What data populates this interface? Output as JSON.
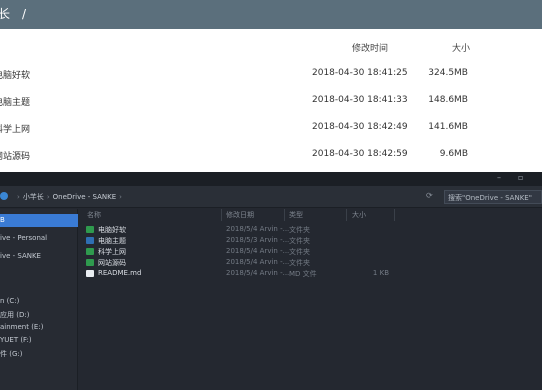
{
  "web": {
    "breadcrumb": {
      "current": "长",
      "separator": "/"
    },
    "columns": {
      "date": "修改时间",
      "size": "大小"
    },
    "rows": [
      {
        "name": "电脑好软",
        "date": "2018-04-30 18:41:25",
        "size": "324.5MB"
      },
      {
        "name": "电脑主题",
        "date": "2018-04-30 18:41:33",
        "size": "148.6MB"
      },
      {
        "name": "科学上网",
        "date": "2018-04-30 18:42:49",
        "size": "141.6MB"
      },
      {
        "name": "网站源码",
        "date": "2018-04-30 18:42:59",
        "size": "9.6MB"
      }
    ]
  },
  "explorer": {
    "titlebar": {
      "minimize": "–",
      "maximize": "▫"
    },
    "address": {
      "segments": [
        "小芊长",
        "OneDrive - SANKE"
      ],
      "search_placeholder": "搜索\"OneDrive - SANKE\""
    },
    "sidebar": [
      {
        "label": "B",
        "selected": true
      },
      {
        "label": "ive - Personal",
        "selected": false
      },
      {
        "label": "ive - SANKE",
        "selected": false
      },
      {
        "label": "n (C:)",
        "selected": false
      },
      {
        "label": "应用 (D:)",
        "selected": false
      },
      {
        "label": "ainment (E:)",
        "selected": false
      },
      {
        "label": "YUET (F:)",
        "selected": false
      },
      {
        "label": "件 (G:)",
        "selected": false
      }
    ],
    "columns": {
      "name": "名称",
      "date": "修改日期",
      "type": "类型",
      "size": "大小"
    },
    "files": [
      {
        "name": "电脑好软",
        "date": "2018/5/4 Arvin -...",
        "type": "文件夹",
        "size": "",
        "icon": "folder-icon"
      },
      {
        "name": "电脑主题",
        "date": "2018/5/3 Arvin -...",
        "type": "文件夹",
        "size": "",
        "icon": "folder-icon"
      },
      {
        "name": "科学上网",
        "date": "2018/5/4 Arvin -...",
        "type": "文件夹",
        "size": "",
        "icon": "folder-icon"
      },
      {
        "name": "网站源码",
        "date": "2018/5/4 Arvin -...",
        "type": "文件夹",
        "size": "",
        "icon": "folder-icon"
      },
      {
        "name": "README.md",
        "date": "2018/5/4 Arvin -...",
        "type": "MD 文件",
        "size": "1 KB",
        "icon": "file-icon"
      }
    ]
  }
}
